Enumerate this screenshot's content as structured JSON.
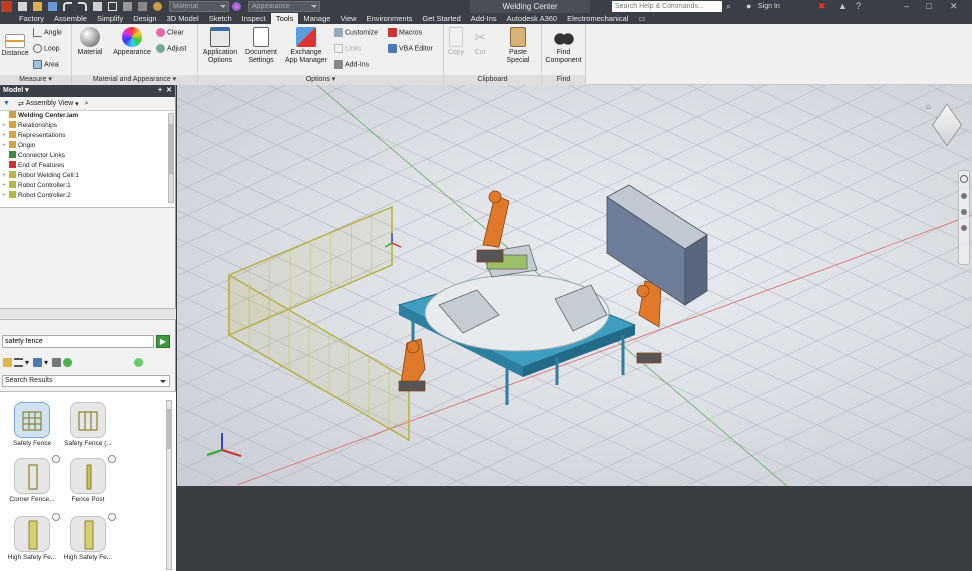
{
  "qat": {
    "material_placeholder": "Material",
    "appearance_placeholder": "Appearance",
    "window_title": "Welding Center",
    "search_placeholder": "Search Help & Commands...",
    "sign_in": "Sign In"
  },
  "tabs": [
    "Factory",
    "Assemble",
    "Simplify",
    "Design",
    "3D Model",
    "Sketch",
    "Inspect",
    "Tools",
    "Manage",
    "View",
    "Environments",
    "Get Started",
    "Add-Ins",
    "Autodesk A360",
    "Electromechanical"
  ],
  "active_tab": "Tools",
  "ribbon": {
    "measure": {
      "title": "Measure",
      "distance": "Distance",
      "angle": "Angle",
      "loop": "Loop",
      "area": "Area"
    },
    "material": {
      "title": "Material and Appearance",
      "material": "Material",
      "appearance": "Appearance",
      "clear": "Clear",
      "adjust": "Adjust"
    },
    "options": {
      "title": "Options",
      "app_options_1": "Application",
      "app_options_2": "Options",
      "doc_settings_1": "Document",
      "doc_settings_2": "Settings",
      "exchange_1": "Exchange",
      "exchange_2": "App Manager",
      "customize": "Customize",
      "links": "Links",
      "addins": "Add-Ins",
      "macros": "Macros",
      "vba": "VBA Editor"
    },
    "clipboard": {
      "title": "Clipboard",
      "copy": "Copy",
      "cut": "Cut",
      "paste_1": "Paste",
      "paste_2": "Special"
    },
    "find": {
      "title": "Find",
      "find_1": "Find",
      "find_2": "Component"
    }
  },
  "model_panel": {
    "header": "Model",
    "assembly_view": "Assembly View",
    "tree": [
      {
        "label": "Welding Center.iam",
        "toggle": "",
        "color": "#c8a040",
        "bold": true
      },
      {
        "label": "Relationships",
        "toggle": "+",
        "color": "#d9a440"
      },
      {
        "label": "Representations",
        "toggle": "+",
        "color": "#d9a440"
      },
      {
        "label": "Origin",
        "toggle": "+",
        "color": "#d9a440"
      },
      {
        "label": "Connector Links",
        "toggle": "",
        "color": "#3a8a3a"
      },
      {
        "label": "End of Features",
        "toggle": "",
        "color": "#cc3333"
      },
      {
        "label": "Robot Welding Cell:1",
        "toggle": "+",
        "color": "#b8b840"
      },
      {
        "label": "Robot Controller:1",
        "toggle": "+",
        "color": "#b8b840"
      },
      {
        "label": "Robot Controller:2",
        "toggle": "+",
        "color": "#b8b840"
      }
    ]
  },
  "content_panel": {
    "search_value": "safety fence",
    "results_dropdown": "Search Results",
    "items": [
      {
        "label": "Safety Fence",
        "selected": true
      },
      {
        "label": "Safety Fence (...",
        "selected": false
      },
      {
        "label": "Corner Fence...",
        "selected": false
      },
      {
        "label": "Fence Post",
        "selected": false
      },
      {
        "label": "High Safety Fe...",
        "selected": false
      },
      {
        "label": "High Safety Fe...",
        "selected": false
      }
    ]
  },
  "colors": {
    "ribbon_bg": "#f0f0f0",
    "dark_chrome": "#3b3f45",
    "robot_orange": "#e07a2a",
    "table_teal": "#3f9ec0",
    "fence_yellow": "#c8c05a"
  }
}
